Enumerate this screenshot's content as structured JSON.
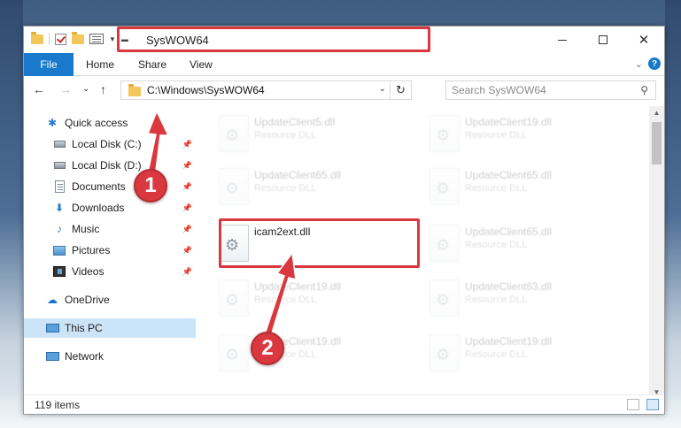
{
  "window": {
    "title": "SysWOW64",
    "minimize_icon": "minimize-icon",
    "maximize_icon": "maximize-icon",
    "close_icon": "close-icon"
  },
  "ribbon": {
    "tabs": [
      "File",
      "Home",
      "Share",
      "View"
    ],
    "help": "?"
  },
  "navbar": {
    "back": "←",
    "forward": "→",
    "recent": "⌄",
    "up": "↑",
    "address": "C:\\Windows\\SysWOW64",
    "refresh": "↻",
    "search_placeholder": "Search SysWOW64",
    "search_icon": "⚲"
  },
  "nav_pane": {
    "items": [
      {
        "label": "Quick access",
        "icon": "star-icon",
        "pinned": false
      },
      {
        "label": "Local Disk (C:)",
        "icon": "drive-icon",
        "pinned": true
      },
      {
        "label": "Local Disk (D:)",
        "icon": "drive-icon",
        "pinned": true
      },
      {
        "label": "Documents",
        "icon": "documents-icon",
        "pinned": true
      },
      {
        "label": "Downloads",
        "icon": "downloads-icon",
        "pinned": true
      },
      {
        "label": "Music",
        "icon": "music-icon",
        "pinned": true
      },
      {
        "label": "Pictures",
        "icon": "pictures-icon",
        "pinned": true
      },
      {
        "label": "Videos",
        "icon": "videos-icon",
        "pinned": true
      },
      {
        "label": "OneDrive",
        "icon": "onedrive-icon",
        "pinned": false
      },
      {
        "label": "This PC",
        "icon": "this-pc-icon",
        "pinned": false,
        "selected": true
      },
      {
        "label": "Network",
        "icon": "network-icon",
        "pinned": false
      }
    ],
    "pin_glyph": "📌"
  },
  "files": [
    {
      "name": "UpdateClient5.dll",
      "type": "Resource DLL",
      "faded": true
    },
    {
      "name": "UpdateClient19.dll",
      "type": "Resource DLL",
      "faded": true
    },
    {
      "name": "UpdateClient65.dll",
      "type": "Resource DLL",
      "faded": true
    },
    {
      "name": "UpdateClient65.dll",
      "type": "Resource DLL",
      "faded": true
    },
    {
      "name": "icam2ext.dll",
      "type": "",
      "faded": false
    },
    {
      "name": "UpdateClient65.dll",
      "type": "Resource DLL",
      "faded": true
    },
    {
      "name": "UpdateClient19.dll",
      "type": "Resource DLL",
      "faded": true
    },
    {
      "name": "UpdateClient63.dll",
      "type": "Resource DLL",
      "faded": true
    },
    {
      "name": "UpdateClient19.dll",
      "type": "Resource DLL",
      "faded": true
    },
    {
      "name": "UpdateClient19.dll",
      "type": "Resource DLL",
      "faded": true
    }
  ],
  "status": {
    "item_count": "119 items"
  },
  "annotations": {
    "step1": "1",
    "step2": "2",
    "color": "#d9383f"
  },
  "colors": {
    "accent": "#1979ca",
    "selected": "#cce4f7",
    "highlight": "#d9383f"
  }
}
